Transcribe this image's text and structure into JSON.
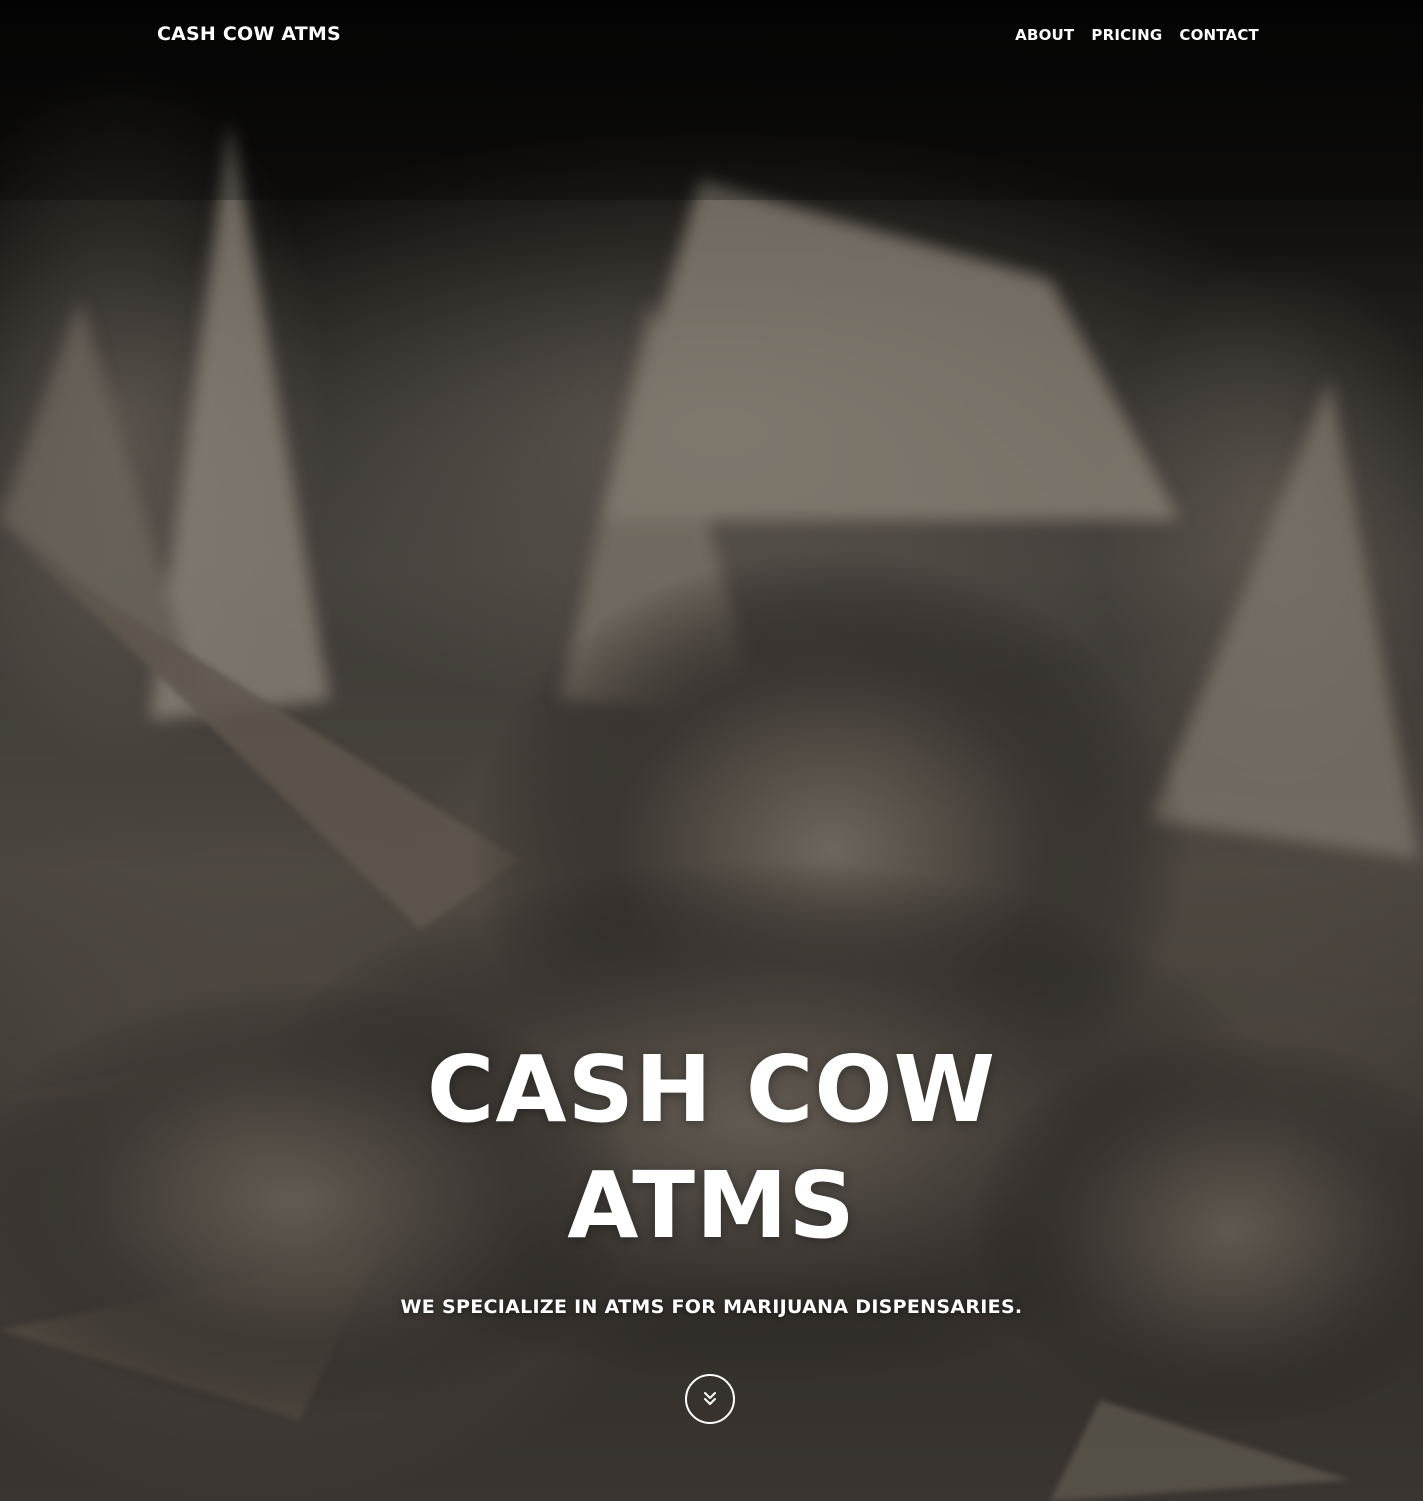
{
  "nav": {
    "brand": "CASH COW ATMS",
    "links": [
      {
        "label": "ABOUT"
      },
      {
        "label": "PRICING"
      },
      {
        "label": "CONTACT"
      }
    ]
  },
  "hero": {
    "title_line1": "CASH COW",
    "title_line2": "ATMS",
    "subtitle": "WE SPECIALIZE IN ATMS FOR MARIJUANA DISPENSARIES.",
    "scroll_icon": "double-chevron-down-icon",
    "background_image": "close-up cannabis bud (sepia monochrome photo)"
  },
  "colors": {
    "text": "#ffffff",
    "background_tone": "#3e3a35"
  }
}
